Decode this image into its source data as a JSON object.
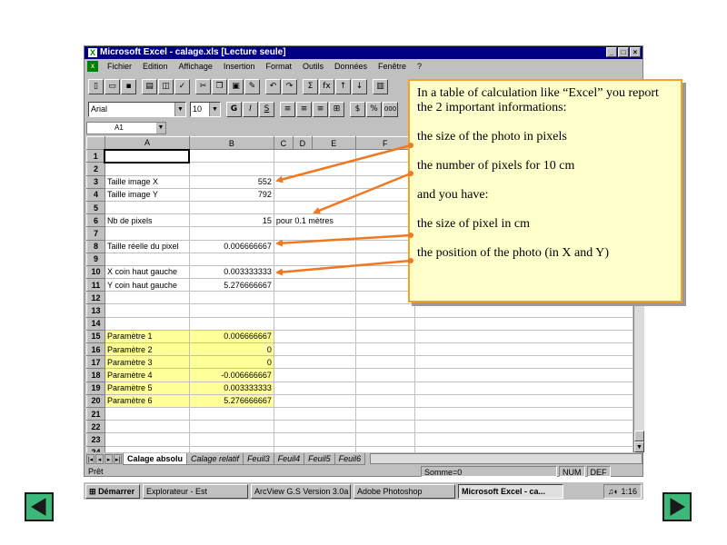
{
  "window": {
    "title": "Microsoft Excel - calage.xls  [Lecture seule]",
    "brand": "Microsoft",
    "controls": [
      "_",
      "□",
      "×"
    ]
  },
  "menu": [
    "Fichier",
    "Edition",
    "Affichage",
    "Insertion",
    "Format",
    "Outils",
    "Données",
    "Fenêtre",
    "?"
  ],
  "toolbar": {
    "font_name": "Arial",
    "font_size": "10",
    "bold": "G",
    "italic": "I",
    "underline": "S",
    "percent": "%",
    "thousands": "000",
    "sum": "Σ",
    "fx": "fx"
  },
  "formula_bar": {
    "name_box": "A1"
  },
  "columns": [
    "",
    "A",
    "B",
    "C",
    "D",
    "E",
    "F"
  ],
  "rows": [
    {
      "n": "1",
      "a": "",
      "b": "",
      "c": ""
    },
    {
      "n": "2",
      "a": "",
      "b": "",
      "c": ""
    },
    {
      "n": "3",
      "a": "Taille image X",
      "b": "552",
      "c": ""
    },
    {
      "n": "4",
      "a": "Taille image Y",
      "b": "792",
      "c": ""
    },
    {
      "n": "5",
      "a": "",
      "b": "",
      "c": ""
    },
    {
      "n": "6",
      "a": "Nb de pixels",
      "b": "15",
      "c": "pour   0.1 mètres"
    },
    {
      "n": "7",
      "a": "",
      "b": "",
      "c": ""
    },
    {
      "n": "8",
      "a": "Taille réelle du pixel",
      "b": "0.006666667",
      "c": ""
    },
    {
      "n": "9",
      "a": "",
      "b": "",
      "c": ""
    },
    {
      "n": "10",
      "a": "X coin haut gauche",
      "b": "0.003333333",
      "c": ""
    },
    {
      "n": "11",
      "a": "Y coin haut gauche",
      "b": "5.276666667",
      "c": ""
    },
    {
      "n": "12",
      "a": "",
      "b": "",
      "c": ""
    },
    {
      "n": "13",
      "a": "",
      "b": "",
      "c": ""
    },
    {
      "n": "14",
      "a": "",
      "b": "",
      "c": ""
    },
    {
      "n": "15",
      "a": "Paramètre 1",
      "b": "0.006666667",
      "c": "",
      "yellow": true
    },
    {
      "n": "16",
      "a": "Paramètre 2",
      "b": "0",
      "c": "",
      "yellow": true
    },
    {
      "n": "17",
      "a": "Paramètre 3",
      "b": "0",
      "c": "",
      "yellow": true
    },
    {
      "n": "18",
      "a": "Paramètre 4",
      "b": "-0.006666667",
      "c": "",
      "yellow": true
    },
    {
      "n": "19",
      "a": "Paramètre 5",
      "b": "0.003333333",
      "c": "",
      "yellow": true
    },
    {
      "n": "20",
      "a": "Paramètre 6",
      "b": "5.276666667",
      "c": "",
      "yellow": true
    },
    {
      "n": "21",
      "a": "",
      "b": "",
      "c": ""
    },
    {
      "n": "22",
      "a": "",
      "b": "",
      "c": ""
    },
    {
      "n": "23",
      "a": "",
      "b": "",
      "c": ""
    },
    {
      "n": "24",
      "a": "",
      "b": "",
      "c": ""
    }
  ],
  "sheet_tabs": [
    "Calage absolu",
    "Calage relatif",
    "Feuil3",
    "Feuil4",
    "Feuil5",
    "Feuil6"
  ],
  "status": {
    "ready": "Prêt",
    "sum": "Somme=0",
    "num": "NUM",
    "def": "DEF"
  },
  "taskbar": {
    "start": "Démarrer",
    "tasks": [
      "Explorateur - Est",
      "ArcView G.S Version 3.0a",
      "Adobe Photoshop",
      "Microsoft Excel - ca..."
    ],
    "clock": "1:16"
  },
  "callout": {
    "intro": "In a table of calculation like “Excel” you report the 2 important informations:",
    "item1": "the size of the photo in pixels",
    "item2": "the number of pixels for 10 cm",
    "item3": "and you have:",
    "item4": "the size of pixel in cm",
    "item5": "the position of the photo (in X and Y)",
    "border_color": "#f4a21f",
    "bg_color": "#ffffcc",
    "arrow_color": "#f07820"
  },
  "navigation": {
    "prev_icon": "left-triangle-icon",
    "next_icon": "right-triangle-icon",
    "color": "#3cb878"
  }
}
